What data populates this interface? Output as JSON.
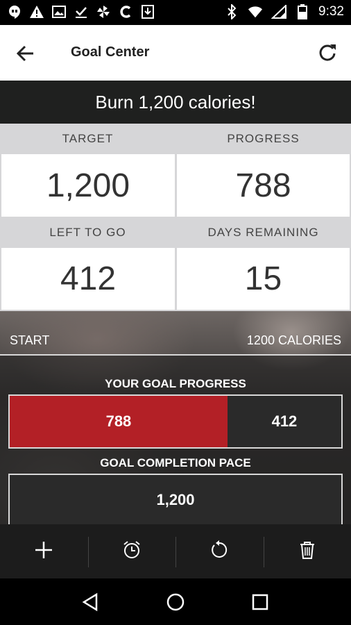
{
  "status_bar": {
    "time": "9:32",
    "left_icons": [
      "hangouts-icon",
      "alert-icon",
      "image-icon",
      "download-done-icon",
      "pinwheel-icon",
      "c-app-icon",
      "download-icon"
    ],
    "right_icons": [
      "bluetooth-icon",
      "wifi-icon",
      "signal-icon",
      "battery-icon"
    ]
  },
  "header": {
    "title": "Goal Center",
    "back_icon": "arrow-back-icon",
    "refresh_icon": "refresh-icon"
  },
  "goal": {
    "title": "Burn 1,200 calories!"
  },
  "stats": {
    "target_label": "TARGET",
    "target_value": "1,200",
    "progress_label": "PROGRESS",
    "progress_value": "788",
    "left_label": "LEFT TO GO",
    "left_value": "412",
    "days_label": "DAYS REMAINING",
    "days_value": "15"
  },
  "range": {
    "start_label": "START",
    "end_label": "1200 CALORIES"
  },
  "goal_progress": {
    "title": "YOUR GOAL PROGRESS",
    "done_value": "788",
    "left_value": "412",
    "fraction_done": 0.6567,
    "done_color": "#b32026"
  },
  "pace": {
    "title": "GOAL COMPLETION PACE",
    "value": "1,200"
  },
  "toolbar": {
    "items": [
      "add-icon",
      "alarm-add-icon",
      "reset-icon",
      "trash-icon"
    ]
  },
  "navbar": {
    "items": [
      "back-triangle-icon",
      "home-circle-icon",
      "recents-square-icon"
    ]
  }
}
